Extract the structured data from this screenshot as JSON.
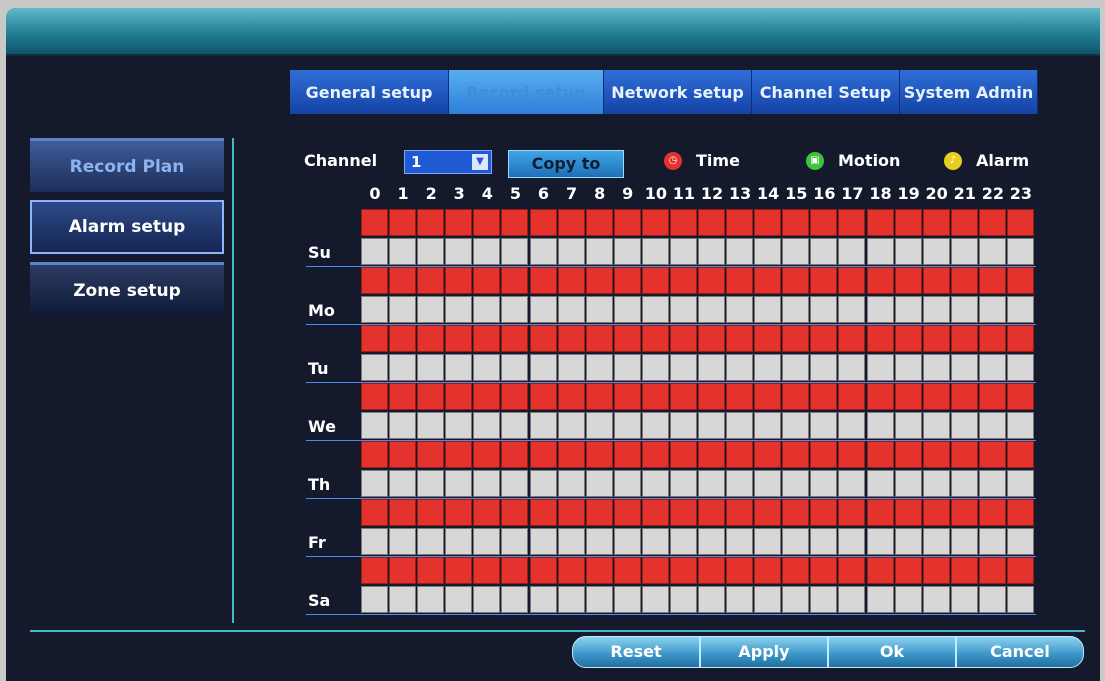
{
  "tabs": [
    "General setup",
    "Record setup",
    "Network setup",
    "Channel Setup",
    "System Admin"
  ],
  "active_tab": 1,
  "sidebar": [
    {
      "label": "Record Plan",
      "active": true
    },
    {
      "label": "Alarm setup",
      "highlighted": true
    },
    {
      "label": "Zone setup"
    }
  ],
  "channel": {
    "label": "Channel",
    "value": "1",
    "arrow_icon": "chevron-down-icon"
  },
  "copy_button": "Copy to",
  "legend": [
    {
      "label": "Time",
      "color": "#e3332c",
      "icon": "clock-icon"
    },
    {
      "label": "Motion",
      "color": "#3cc23c",
      "icon": "motion-icon"
    },
    {
      "label": "Alarm",
      "color": "#e8cf1f",
      "icon": "alarm-icon"
    }
  ],
  "hours": [
    "0",
    "1",
    "2",
    "3",
    "4",
    "5",
    "6",
    "7",
    "8",
    "9",
    "10",
    "11",
    "12",
    "13",
    "14",
    "15",
    "16",
    "17",
    "18",
    "19",
    "20",
    "21",
    "22",
    "23"
  ],
  "days": [
    "Su",
    "Mo",
    "Tu",
    "We",
    "Th",
    "Fr",
    "Sa"
  ],
  "schedule": {
    "rows_per_day": 2,
    "row_modes": [
      "time",
      "none"
    ],
    "colors": {
      "time": "#e3332c",
      "none": "#d7d7d7"
    }
  },
  "buttons": [
    "Reset",
    "Apply",
    "Ok",
    "Cancel"
  ]
}
